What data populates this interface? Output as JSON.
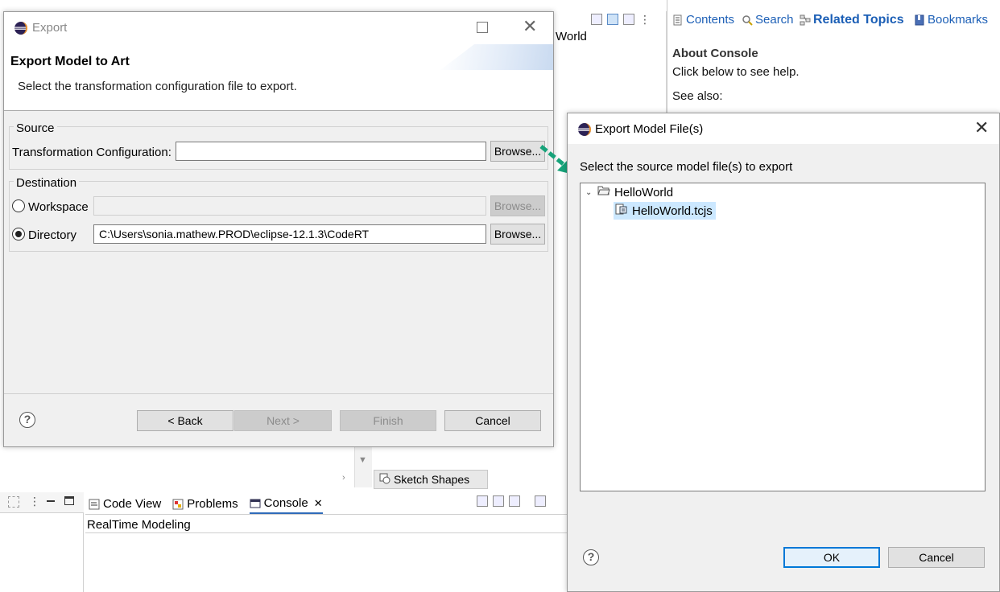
{
  "background": {
    "help_tabs": [
      {
        "label": "Contents",
        "icon": "contents-icon"
      },
      {
        "label": "Search",
        "icon": "search-icon"
      },
      {
        "label": "Related Topics",
        "icon": "related-topics-icon"
      },
      {
        "label": "Bookmarks",
        "icon": "bookmarks-icon"
      }
    ],
    "help_heading": "About Console",
    "help_text": "Click below to see help.",
    "help_see_also": "See also:",
    "editor_text": "World",
    "sketch_tab": "Sketch Shapes",
    "view_tabs": [
      {
        "label": "Code View",
        "icon": "code-view-icon"
      },
      {
        "label": "Problems",
        "icon": "problems-icon"
      },
      {
        "label": "Console",
        "icon": "console-icon"
      }
    ],
    "console_tab_close": "✕",
    "console_line": "RealTime Modeling"
  },
  "export_dialog": {
    "title": "Export",
    "heading": "Export Model to Art",
    "description": "Select the transformation configuration file to export.",
    "source": {
      "group_label": "Source",
      "field_label": "Transformation Configuration:",
      "value": "",
      "browse_label": "Browse..."
    },
    "destination": {
      "group_label": "Destination",
      "workspace_label": "Workspace",
      "workspace_value": "",
      "workspace_browse": "Browse...",
      "directory_label": "Directory",
      "directory_value": "C:\\Users\\sonia.mathew.PROD\\eclipse-12.1.3\\CodeRT",
      "directory_browse": "Browse..."
    },
    "help_symbol": "?",
    "buttons": {
      "back": "< Back",
      "next": "Next >",
      "finish": "Finish",
      "cancel": "Cancel"
    }
  },
  "files_dialog": {
    "title": "Export Model File(s)",
    "description": "Select the source model file(s) to export",
    "tree": [
      {
        "label": "HelloWorld",
        "type": "folder",
        "expanded": true
      },
      {
        "label": "HelloWorld.tcjs",
        "type": "file",
        "selected": true
      }
    ],
    "help_symbol": "?",
    "buttons": {
      "ok": "OK",
      "cancel": "Cancel"
    }
  },
  "colors": {
    "arrow": "#17a37a",
    "link_blue": "#1c5fb6",
    "selection": "#cce8ff",
    "default_button_border": "#0078d7"
  }
}
